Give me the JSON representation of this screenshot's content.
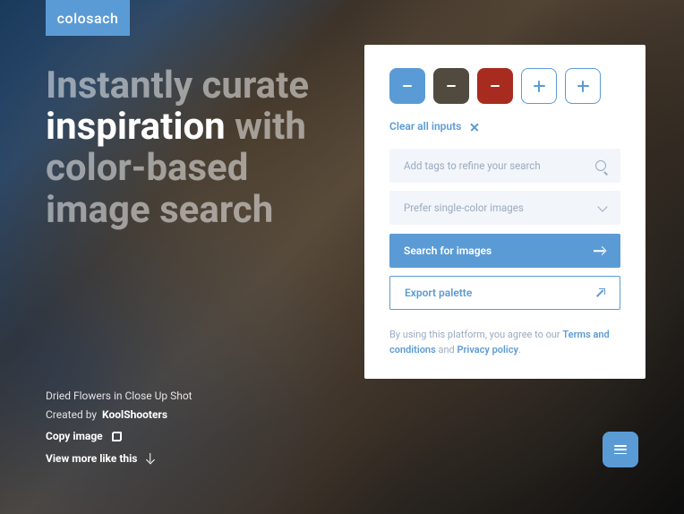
{
  "brand": {
    "name": "colosach"
  },
  "heading": {
    "part1": "Instantly curate",
    "highlight": "inspiration",
    "part2": " with color-based image search"
  },
  "panel": {
    "swatches": {
      "colors": [
        "#5b9bd5",
        "#514a3f",
        "#a82b1f"
      ]
    },
    "clear_label": "Clear all inputs",
    "tags_placeholder": "Add tags to refine your search",
    "preference_label": "Prefer single-color images",
    "search_label": "Search for images",
    "export_label": "Export palette",
    "legal": {
      "prefix": "By using this platform, you agree to our ",
      "terms": "Terms and conditions",
      "middle": " and ",
      "privacy": "Privacy policy",
      "suffix": "."
    }
  },
  "image_meta": {
    "title": "Dried Flowers in Close Up Shot",
    "created_by_label": "Created by",
    "creator": "KoolShooters",
    "copy_label": "Copy image",
    "more_label": "View more like this"
  }
}
